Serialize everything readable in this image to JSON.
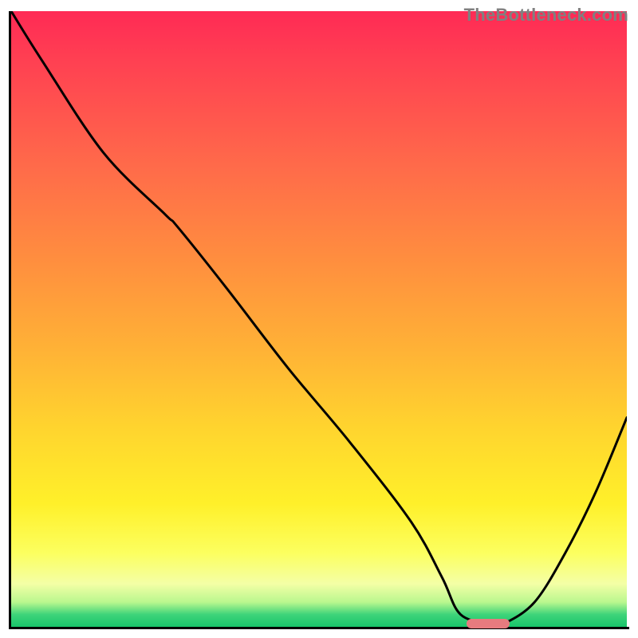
{
  "attribution": "TheBottleneck.com",
  "chart_data": {
    "type": "line",
    "note": "Axes are unlabeled in the image; x and y normalized to 0–100 of plot area. y = 0 at bottom (green), y = 100 at top (red). The curve is a single black line starting top-left, descending to a flat minimum near x ≈ 72–80, then rising toward the right edge.",
    "x": [
      0,
      5,
      15,
      25,
      27,
      35,
      45,
      55,
      65,
      70,
      73,
      78,
      80,
      85,
      90,
      95,
      100
    ],
    "values": [
      100,
      92,
      77,
      67,
      65,
      55,
      42,
      30,
      17,
      8,
      2,
      0.5,
      0.5,
      4,
      12,
      22,
      34
    ],
    "xlim": [
      0,
      100
    ],
    "ylim": [
      0,
      100
    ],
    "title": "",
    "xlabel": "",
    "ylabel": "",
    "background_gradient_stops": [
      {
        "pct": 0,
        "color": "#ff2a55"
      },
      {
        "pct": 25,
        "color": "#ff6a4a"
      },
      {
        "pct": 55,
        "color": "#ffb236"
      },
      {
        "pct": 80,
        "color": "#fff02a"
      },
      {
        "pct": 96,
        "color": "#b9f78e"
      },
      {
        "pct": 100,
        "color": "#18c56b"
      }
    ],
    "marker": {
      "x_start": 74,
      "x_end": 81,
      "y": 0.5,
      "color": "#e77b7f"
    }
  }
}
